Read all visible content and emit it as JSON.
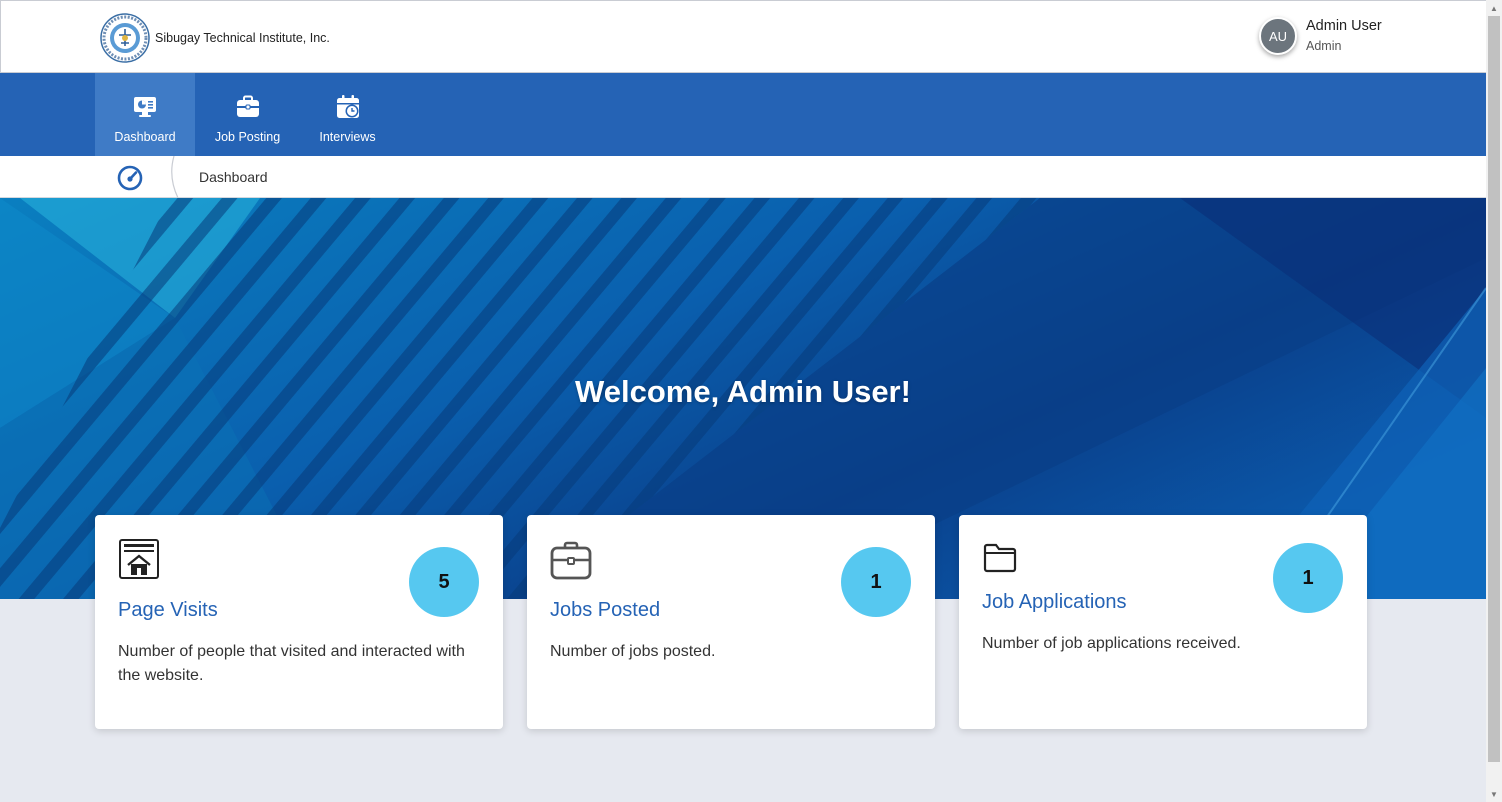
{
  "header": {
    "brand_name": "Sibugay Technical Institute, Inc.",
    "user": {
      "initials": "AU",
      "name": "Admin User",
      "role": "Admin"
    }
  },
  "nav": {
    "items": [
      {
        "label": "Dashboard",
        "icon": "dashboard-icon",
        "active": true
      },
      {
        "label": "Job Posting",
        "icon": "briefcase-icon",
        "active": false
      },
      {
        "label": "Interviews",
        "icon": "calendar-clock-icon",
        "active": false
      }
    ]
  },
  "breadcrumb": {
    "icon": "speedometer-icon",
    "current": "Dashboard"
  },
  "hero": {
    "title": "Welcome, Admin User!"
  },
  "cards": [
    {
      "title": "Page Visits",
      "count": "5",
      "description": "Number of people that visited and interacted with the website.",
      "icon": "webpage-home-icon"
    },
    {
      "title": "Jobs Posted",
      "count": "1",
      "description": "Number of jobs posted.",
      "icon": "briefcase-icon"
    },
    {
      "title": "Job Applications",
      "count": "1",
      "description": "Number of job applications received.",
      "icon": "folder-icon"
    }
  ],
  "colors": {
    "nav_bg": "#2563b5",
    "nav_active": "#3f7bc6",
    "badge": "#56c8f0",
    "card_title": "#2563b5",
    "page_bg": "#e6e9f0"
  }
}
